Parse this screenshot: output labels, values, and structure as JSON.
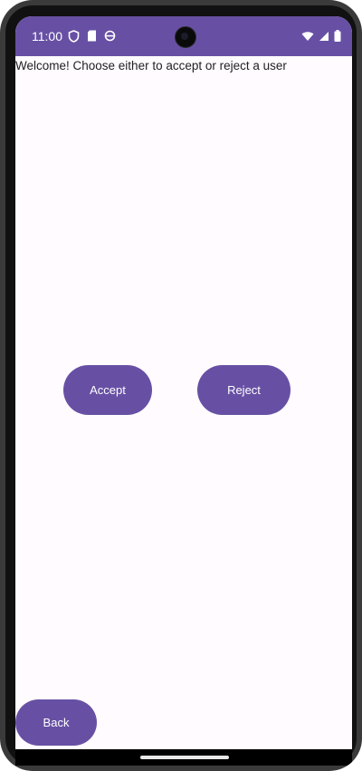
{
  "status_bar": {
    "time": "11:00",
    "left_icons": [
      "shield-icon",
      "sd-card-icon",
      "sync-icon"
    ],
    "right_icons": [
      "wifi-icon",
      "signal-icon",
      "battery-icon"
    ],
    "color": "#6750a4"
  },
  "main": {
    "welcome_text": "Welcome! Choose either to accept or reject a user",
    "accept_label": "Accept",
    "reject_label": "Reject",
    "back_label": "Back"
  },
  "colors": {
    "primary": "#6750a4",
    "background": "#fffbfe",
    "on_primary": "#ffffff"
  }
}
